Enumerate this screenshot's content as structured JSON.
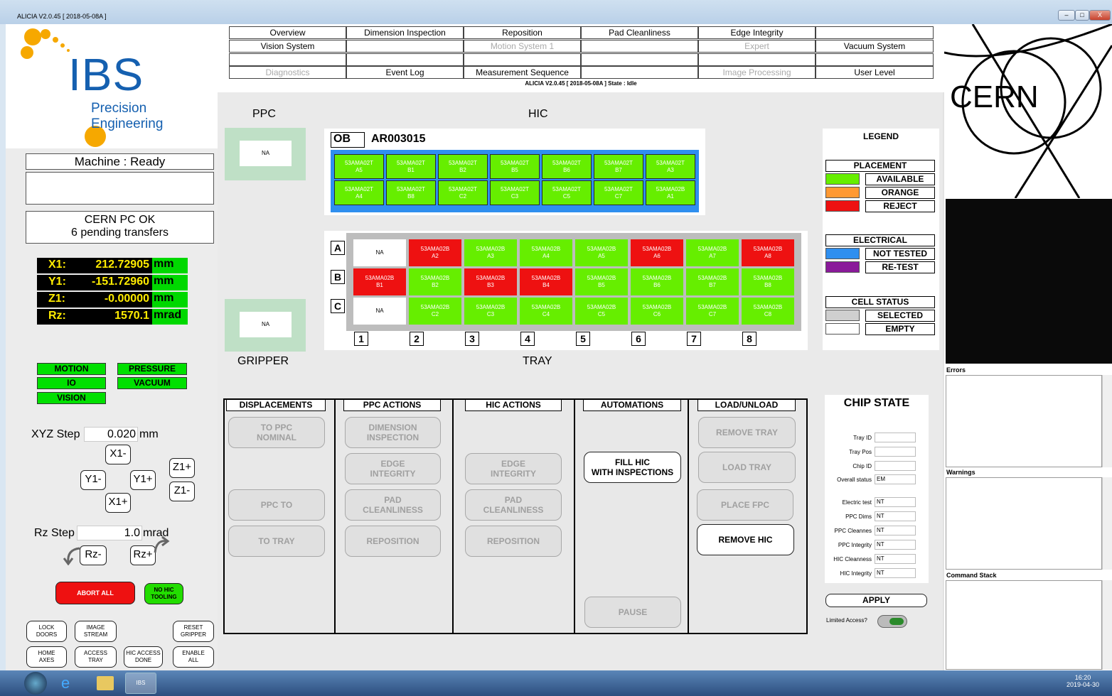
{
  "window": {
    "title": "ALICIA V2.0.45 [ 2018-05-08A ]",
    "min": "–",
    "max": "□",
    "close": "X"
  },
  "logo": {
    "text": "IBS",
    "sub": "Precision Engineering"
  },
  "status": {
    "machine": "Machine : Ready",
    "pc_line1": "CERN PC OK",
    "pc_line2": "6 pending transfers"
  },
  "coords": [
    {
      "label": "X1:",
      "value": "212.72905",
      "unit": "mm"
    },
    {
      "label": "Y1:",
      "value": "-151.72960",
      "unit": "mm"
    },
    {
      "label": "Z1:",
      "value": "-0.00000",
      "unit": "mm"
    },
    {
      "label": "Rz:",
      "value": "1570.1",
      "unit": "mrad"
    }
  ],
  "indicators": {
    "motion": "MOTION",
    "pressure": "PRESSURE",
    "io": "IO",
    "vacuum": "VACUUM",
    "vision": "VISION"
  },
  "jog": {
    "xyz_label": "XYZ Step",
    "xyz_value": "0.020",
    "xyz_unit": "mm",
    "x1m": "X1-",
    "y1m": "Y1-",
    "y1p": "Y1+",
    "x1p": "X1+",
    "z1p": "Z1+",
    "z1m": "Z1-",
    "rz_label": "Rz Step",
    "rz_value": "1.0",
    "rz_unit": "mrad",
    "rzm": "Rz-",
    "rzp": "Rz+"
  },
  "buttons": {
    "abort": "ABORT ALL",
    "nohic": "NO HIC\nTOOLING",
    "lock": "LOCK\nDOORS",
    "image": "IMAGE\nSTREAM",
    "reset": "RESET\nGRIPPER",
    "home": "HOME\nAXES",
    "access": "ACCESS\nTRAY",
    "hicaccess": "HIC ACCESS\nDONE",
    "enable": "ENABLE\nALL"
  },
  "menu": {
    "r1": [
      "Overview",
      "Dimension Inspection",
      "Reposition",
      "Pad Cleanliness",
      "Edge Integrity",
      ""
    ],
    "r2": [
      "Vision System",
      "",
      "Motion System 1",
      "",
      "Expert",
      "Vacuum System"
    ],
    "r3": [
      "",
      "",
      "",
      "",
      "",
      ""
    ],
    "r4": [
      "Diagnostics",
      "Event Log",
      "Measurement Sequence",
      "",
      "Image Processing",
      "User Level"
    ],
    "state": "ALICIA V2.0.45 [ 2018-05-08A ] State : Idle"
  },
  "main": {
    "ppc": "PPC",
    "hic": "HIC",
    "gripper": "GRIPPER",
    "tray": "TRAY",
    "ppc_na": "NA",
    "gripper_na": "NA",
    "ob": "OB",
    "hic_id": "AR003015"
  },
  "hic_cells": [
    "53AMA02T\nA5",
    "53AMA02T\nB1",
    "53AMA02T\nB2",
    "53AMA02T\nB5",
    "53AMA02T\nB6",
    "53AMA02T\nB7",
    "53AMA02T\nA3",
    "53AMA02T\nA4",
    "53AMA02T\nB8",
    "53AMA02T\nC2",
    "53AMA02T\nC3",
    "53AMA02T\nC5",
    "53AMA02T\nC7",
    "53AMA02B\nA1"
  ],
  "tray": {
    "rows": [
      "A",
      "B",
      "C"
    ],
    "cols": [
      "1",
      "2",
      "3",
      "4",
      "5",
      "6",
      "7",
      "8"
    ],
    "cells": [
      [
        "NA",
        "53AMA02B\nA2",
        "53AMA02B\nA3",
        "53AMA02B\nA4",
        "53AMA02B\nA5",
        "53AMA02B\nA6",
        "53AMA02B\nA7",
        "53AMA02B\nA8"
      ],
      [
        "53AMA02B\nB1",
        "53AMA02B\nB2",
        "53AMA02B\nB3",
        "53AMA02B\nB4",
        "53AMA02B\nB5",
        "53AMA02B\nB6",
        "53AMA02B\nB7",
        "53AMA02B\nB8"
      ],
      [
        "NA",
        "53AMA02B\nC2",
        "53AMA02B\nC3",
        "53AMA02B\nC4",
        "53AMA02B\nC5",
        "53AMA02B\nC6",
        "53AMA02B\nC7",
        "53AMA02B\nC8"
      ]
    ],
    "status": [
      [
        "w",
        "r",
        "g",
        "g",
        "g",
        "r",
        "g",
        "r"
      ],
      [
        "r",
        "g",
        "r",
        "r",
        "g",
        "g",
        "g",
        "g"
      ],
      [
        "w",
        "g",
        "g",
        "g",
        "g",
        "g",
        "g",
        "g"
      ]
    ]
  },
  "legend": {
    "title": "LEGEND",
    "placement": "PLACEMENT",
    "available": "AVAILABLE",
    "orange": "ORANGE",
    "reject": "REJECT",
    "electrical": "ELECTRICAL",
    "not_tested": "NOT TESTED",
    "retest": "RE-TEST",
    "cell_status": "CELL STATUS",
    "selected": "SELECTED",
    "empty": "EMPTY"
  },
  "sections": {
    "disp": "DISPLACEMENTS",
    "ppc": "PPC ACTIONS",
    "hic": "HIC ACTIONS",
    "auto": "AUTOMATIONS",
    "load": "LOAD/UNLOAD"
  },
  "actions": {
    "to_ppc": "TO PPC\nNOMINAL",
    "ppc_to": "PPC TO",
    "to_tray": "TO TRAY",
    "dim": "DIMENSION\nINSPECTION",
    "edge": "EDGE\nINTEGRITY",
    "pad": "PAD\nCLEANLINESS",
    "repo": "REPOSITION",
    "hedge": "EDGE\nINTEGRITY",
    "hpad": "PAD\nCLEANLINESS",
    "hrepo": "REPOSITION",
    "fill": "FILL HIC\nWITH INSPECTIONS",
    "pause": "PAUSE",
    "remove_tray": "REMOVE TRAY",
    "load_tray": "LOAD TRAY",
    "place_fpc": "PLACE FPC",
    "remove_hic": "REMOVE HIC"
  },
  "chip": {
    "title": "CHIP STATE",
    "fields": [
      {
        "l": "Tray ID",
        "v": ""
      },
      {
        "l": "Tray Pos",
        "v": ""
      },
      {
        "l": "Chip ID",
        "v": ""
      },
      {
        "l": "Overall status",
        "v": "EM"
      },
      {
        "l": "Electric test",
        "v": "NT"
      },
      {
        "l": "PPC Dims",
        "v": "NT"
      },
      {
        "l": "PPC Cleannes",
        "v": "NT"
      },
      {
        "l": "PPC Integrity",
        "v": "NT"
      },
      {
        "l": "HIC Cleanness",
        "v": "NT"
      },
      {
        "l": "HIC Integrity",
        "v": "NT"
      }
    ],
    "apply": "APPLY",
    "limited": "Limited Access?"
  },
  "right": {
    "cern": "CERN",
    "errors": "Errors",
    "warnings": "Warnings",
    "stack": "Command Stack"
  },
  "taskbar": {
    "time": "16:20",
    "date": "2019-04-30",
    "app": "IBS"
  }
}
